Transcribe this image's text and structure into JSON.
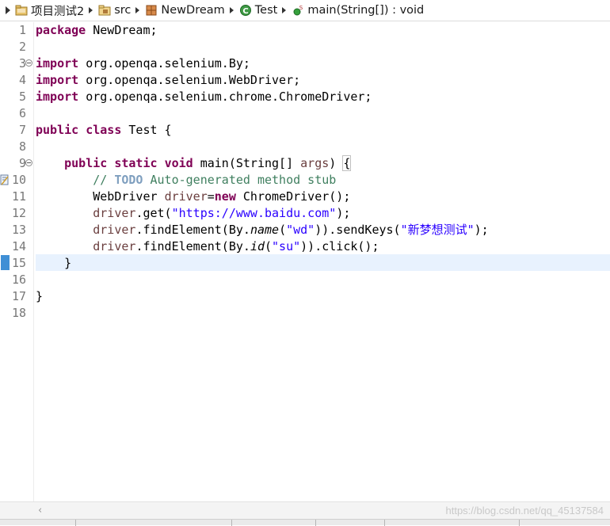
{
  "breadcrumb": {
    "items": [
      {
        "label": "项目测试2",
        "icon": "project-folder-icon"
      },
      {
        "label": "src",
        "icon": "package-folder-icon"
      },
      {
        "label": "NewDream",
        "icon": "package-icon"
      },
      {
        "label": "Test",
        "icon": "class-icon"
      },
      {
        "label": "main(String[]) : void",
        "icon": "static-method-icon"
      }
    ]
  },
  "editor": {
    "line_numbers": [
      "1",
      "2",
      "3",
      "4",
      "5",
      "6",
      "7",
      "8",
      "9",
      "10",
      "11",
      "12",
      "13",
      "14",
      "15",
      "16",
      "17",
      "18"
    ],
    "current_line": 15,
    "code": {
      "l1_kw": "package",
      "l1_rest": " NewDream;",
      "l3_kw": "import",
      "l3_rest": " org.openqa.selenium.By;",
      "l4_kw": "import",
      "l4_rest": " org.openqa.selenium.WebDriver;",
      "l5_kw": "import",
      "l5_rest": " org.openqa.selenium.chrome.ChromeDriver;",
      "l7_kw1": "public",
      "l7_kw2": "class",
      "l7_rest": " Test {",
      "l9_indent": "    ",
      "l9_kw1": "public",
      "l9_kw2": "static",
      "l9_kw3": "void",
      "l9_name": " main(String[] ",
      "l9_arg": "args",
      "l9_close": ") ",
      "l9_brace": "{",
      "l10_indent": "        ",
      "l10_comment": "// ",
      "l10_todo": "TODO",
      "l10_rest": " Auto-generated method stub",
      "l11_indent": "        ",
      "l11_type": "WebDriver ",
      "l11_var": "driver",
      "l11_eq": "=",
      "l11_kw": "new",
      "l11_rest": " ChromeDriver();",
      "l12_indent": "        ",
      "l12_var": "driver",
      "l12_call": ".get(",
      "l12_str": "\"https://www.baidu.com\"",
      "l12_end": ");",
      "l13_indent": "        ",
      "l13_var": "driver",
      "l13_call": ".findElement(By.",
      "l13_it": "name",
      "l13_open": "(",
      "l13_str": "\"wd\"",
      "l13_mid": ")).sendKeys(",
      "l13_str2": "\"新梦想测试\"",
      "l13_end": ");",
      "l14_indent": "        ",
      "l14_var": "driver",
      "l14_call": ".findElement(By.",
      "l14_it": "id",
      "l14_open": "(",
      "l14_str": "\"su\"",
      "l14_end": ")).click();",
      "l15_text": "    }",
      "l17_text": "}"
    }
  },
  "status": {
    "watermark": "https://blog.csdn.net/qq_45137584"
  },
  "colors": {
    "keyword": "#7f0055",
    "string": "#2a00ff",
    "variable": "#6a3e3e",
    "comment": "#3f7f5f",
    "todo": "#7f9fbf",
    "current_line": "#e8f2fe"
  }
}
